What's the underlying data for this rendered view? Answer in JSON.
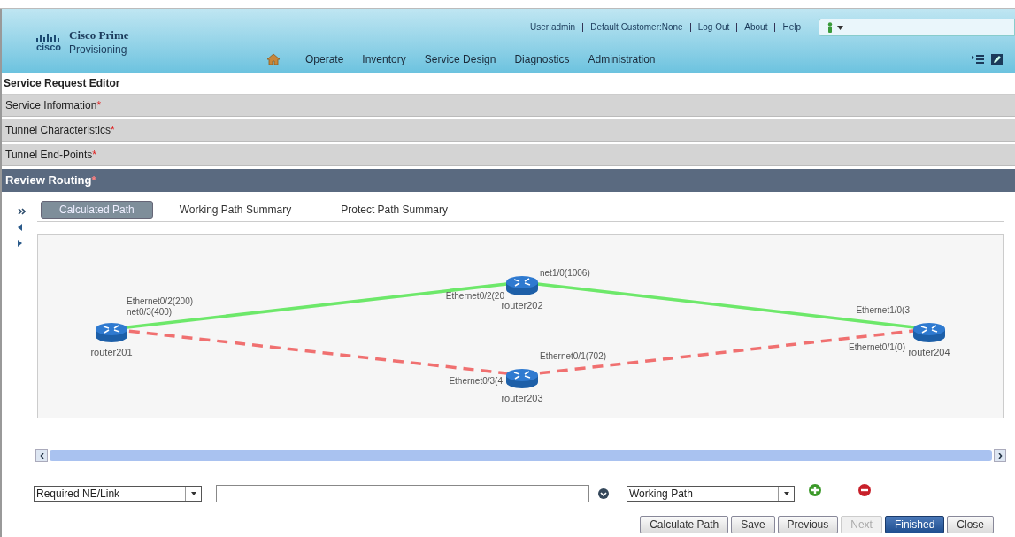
{
  "header": {
    "brand_title": "Cisco Prime",
    "brand_subtitle": "Provisioning",
    "logo_text": "cisco",
    "user_links": [
      "User:admin",
      "Default Customer:None",
      "Log Out",
      "About",
      "Help"
    ],
    "nav": [
      "Operate",
      "Inventory",
      "Service Design",
      "Diagnostics",
      "Administration"
    ]
  },
  "page_title": "Service Request Editor",
  "sections": [
    {
      "label": "Service Information",
      "required_mark": "*",
      "expanded": false
    },
    {
      "label": "Tunnel Characteristics",
      "required_mark": "*",
      "expanded": false
    },
    {
      "label": "Tunnel End-Points",
      "required_mark": "*",
      "expanded": false
    },
    {
      "label": "Review Routing",
      "required_mark": "*",
      "expanded": true
    }
  ],
  "tabs": [
    {
      "label": "Calculated Path",
      "selected": true
    },
    {
      "label": "Working Path Summary",
      "selected": false
    },
    {
      "label": "Protect Path Summary",
      "selected": false
    }
  ],
  "topology": {
    "nodes": [
      {
        "name": "router201",
        "ports": [
          "Ethernet0/2(200)",
          "net0/3(400)"
        ]
      },
      {
        "name": "router202",
        "ports": [
          "Ethernet0/2(20",
          "net1/0(1006)"
        ]
      },
      {
        "name": "router203",
        "ports": [
          "Ethernet0/3(4",
          "Ethernet0/1(702)"
        ]
      },
      {
        "name": "router204",
        "ports": [
          "Ethernet1/0(3",
          "Ethernet0/1(0)"
        ]
      }
    ],
    "links": [
      {
        "kind": "working"
      },
      {
        "kind": "working"
      },
      {
        "kind": "protect"
      },
      {
        "kind": "protect"
      }
    ]
  },
  "controls": {
    "constraint_type": "Required NE/Link",
    "path_type": "Working Path"
  },
  "buttons": [
    {
      "label": "Calculate Path",
      "kind": "default",
      "disabled": false
    },
    {
      "label": "Save",
      "kind": "default",
      "disabled": false
    },
    {
      "label": "Previous",
      "kind": "default",
      "disabled": false
    },
    {
      "label": "Next",
      "kind": "default",
      "disabled": true
    },
    {
      "label": "Finished",
      "kind": "primary",
      "disabled": false
    },
    {
      "label": "Close",
      "kind": "default",
      "disabled": false
    }
  ]
}
